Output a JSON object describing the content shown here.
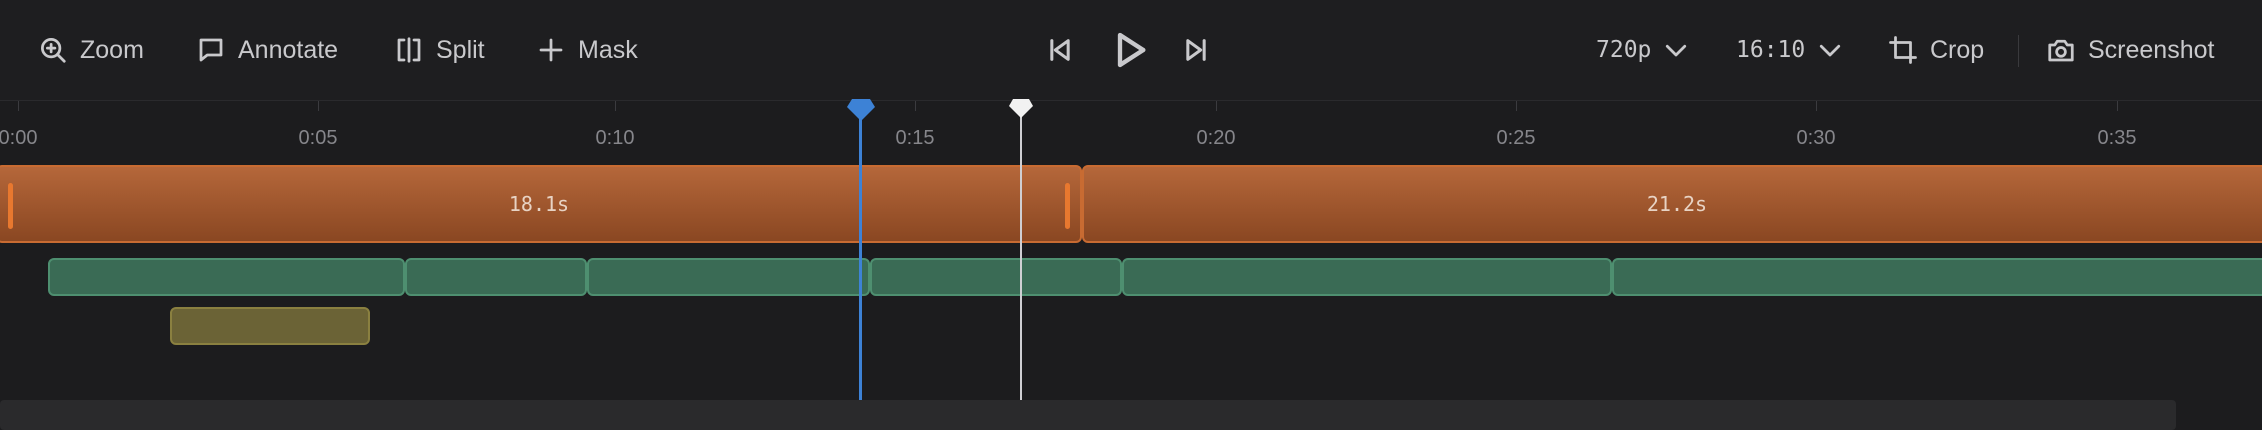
{
  "toolbar": {
    "zoom_label": "Zoom",
    "annotate_label": "Annotate",
    "split_label": "Split",
    "mask_label": "Mask",
    "resolution_label": "720p",
    "aspect_label": "16:10",
    "crop_label": "Crop",
    "screenshot_label": "Screenshot"
  },
  "ruler": {
    "labels": [
      "0:00",
      "0:05",
      "0:10",
      "0:15",
      "0:20",
      "0:25",
      "0:30",
      "0:35"
    ]
  },
  "clips": {
    "clip1_duration": "18.1s",
    "clip2_duration": "21.2s"
  },
  "colors": {
    "accent_playhead": "#3d82d6",
    "clip_orange": "#b5673a",
    "clip_green": "#3a6b55",
    "clip_olive": "#6b6336"
  }
}
